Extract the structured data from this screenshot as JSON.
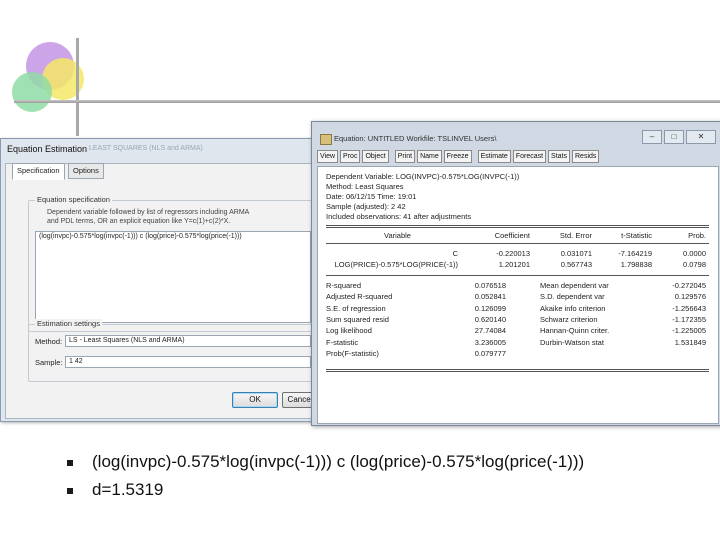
{
  "dialog": {
    "title": "Equation Estimation",
    "title_dim": "LEAST SQUARES (NLS and ARMA)",
    "tabs": [
      "Specification",
      "Options"
    ],
    "spec_group_label": "Equation specification",
    "spec_note_1": "Dependent variable followed by list of regressors including ARMA",
    "spec_note_2": "and PDL terms, OR an explicit equation like Y=c(1)+c(2)*X.",
    "equation": "(log(invpc)-0.575*log(invpc(-1))) c (log(price)-0.575*log(price(-1)))",
    "settings_group_label": "Estimation settings",
    "method_label": "Method:",
    "method_value": "LS - Least Squares (NLS and ARMA)",
    "sample_label": "Sample:",
    "sample_value": "1 42",
    "ok_label": "OK",
    "cancel_label": "Cancel"
  },
  "window": {
    "title": "Equation: UNTITLED   Workfile: TSLINVEL Users\\",
    "toolbar": [
      "View",
      "Proc",
      "Object",
      "Print",
      "Name",
      "Freeze",
      "Estimate",
      "Forecast",
      "Stats",
      "Resids"
    ],
    "header": [
      "Dependent Variable: LOG(INVPC)-0.575*LOG(INVPC(-1))",
      "Method: Least Squares",
      "Date: 06/12/15   Time: 19:01",
      "Sample (adjusted): 2 42",
      "Included observations: 41 after adjustments"
    ],
    "coef_headers": [
      "Variable",
      "Coefficient",
      "Std. Error",
      "t-Statistic",
      "Prob."
    ],
    "coef_rows": [
      [
        "C",
        "-0.220013",
        "0.031071",
        "-7.164219",
        "0.0000"
      ],
      [
        "LOG(PRICE)-0.575*LOG(PRICE(-1))",
        "1.201201",
        "0.567743",
        "1.798838",
        "0.0798"
      ]
    ],
    "stats_rows": [
      [
        "R-squared",
        "0.076518",
        "Mean dependent var",
        "-0.272045"
      ],
      [
        "Adjusted R-squared",
        "0.052841",
        "S.D. dependent var",
        "0.129576"
      ],
      [
        "S.E. of regression",
        "0.126099",
        "Akaike info criterion",
        "-1.256643"
      ],
      [
        "Sum squared resid",
        "0.620140",
        "Schwarz criterion",
        "-1.172355"
      ],
      [
        "Log likelihood",
        "27.74084",
        "Hannan-Quinn criter.",
        "-1.225005"
      ],
      [
        "F-statistic",
        "3.236005",
        "Durbin-Watson stat",
        "1.531849"
      ],
      [
        "Prob(F-statistic)",
        "0.079777",
        "",
        ""
      ]
    ]
  },
  "bullets": [
    "(log(invpc)-0.575*log(invpc(-1))) c (log(price)-0.575*log(price(-1)))",
    "d=1.5319"
  ]
}
